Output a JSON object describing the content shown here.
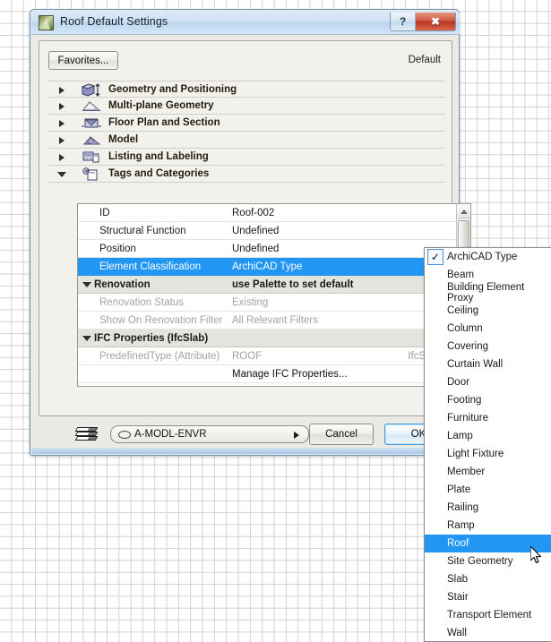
{
  "window": {
    "title": "Roof Default Settings",
    "app_icon": "archicad-roof-icon",
    "help_button": "?",
    "close_button": "✖"
  },
  "toolbar": {
    "favorites_label": "Favorites...",
    "default_label": "Default"
  },
  "tree": {
    "items": [
      {
        "label": "Geometry and Positioning",
        "expanded": false,
        "icon": "geometry-icon"
      },
      {
        "label": "Multi-plane Geometry",
        "expanded": false,
        "icon": "multiplane-icon"
      },
      {
        "label": "Floor Plan and Section",
        "expanded": false,
        "icon": "floorplan-icon"
      },
      {
        "label": "Model",
        "expanded": false,
        "icon": "model-icon"
      },
      {
        "label": "Listing and Labeling",
        "expanded": false,
        "icon": "listing-icon"
      },
      {
        "label": "Tags and Categories",
        "expanded": true,
        "icon": "tags-icon"
      }
    ]
  },
  "grid": {
    "rows": [
      {
        "key": "ID",
        "value": "Roof-002",
        "type": "normal"
      },
      {
        "key": "Structural Function",
        "value": "Undefined",
        "type": "normal"
      },
      {
        "key": "Position",
        "value": "Undefined",
        "type": "normal"
      },
      {
        "key": "Element Classification",
        "value": "ArchiCAD Type",
        "type": "selected"
      },
      {
        "key": "Renovation",
        "value": "use Palette to set default",
        "type": "section"
      },
      {
        "key": "Renovation Status",
        "value": "Existing",
        "type": "dim",
        "extra_icon": "renovation-status-icon"
      },
      {
        "key": "Show On Renovation Filter",
        "value": "All Relevant Filters",
        "type": "dim"
      },
      {
        "key": "IFC Properties (IfcSlab)",
        "value": "",
        "type": "section"
      },
      {
        "key": "PredefinedType (Attribute)",
        "value": "ROOF",
        "type": "dim",
        "extra": "IfcSlab..."
      },
      {
        "key": "",
        "value": "Manage IFC Properties...",
        "type": "manage"
      }
    ]
  },
  "footer": {
    "layers_icon": "layers-icon",
    "layer_value": "A-MODL-ENVR",
    "cancel_label": "Cancel",
    "ok_label": "OK"
  },
  "menu": {
    "items": [
      {
        "label": "ArchiCAD Type",
        "state": "checked"
      },
      {
        "label": "Beam",
        "state": "normal"
      },
      {
        "label": "Building Element Proxy",
        "state": "normal"
      },
      {
        "label": "Ceiling",
        "state": "normal"
      },
      {
        "label": "Column",
        "state": "normal"
      },
      {
        "label": "Covering",
        "state": "normal"
      },
      {
        "label": "Curtain Wall",
        "state": "normal"
      },
      {
        "label": "Door",
        "state": "normal"
      },
      {
        "label": "Footing",
        "state": "normal"
      },
      {
        "label": "Furniture",
        "state": "normal"
      },
      {
        "label": "Lamp",
        "state": "normal"
      },
      {
        "label": "Light Fixture",
        "state": "normal"
      },
      {
        "label": "Member",
        "state": "normal"
      },
      {
        "label": "Plate",
        "state": "normal"
      },
      {
        "label": "Railing",
        "state": "normal"
      },
      {
        "label": "Ramp",
        "state": "normal"
      },
      {
        "label": "Roof",
        "state": "highlighted"
      },
      {
        "label": "Site Geometry",
        "state": "normal"
      },
      {
        "label": "Slab",
        "state": "normal"
      },
      {
        "label": "Stair",
        "state": "normal"
      },
      {
        "label": "Transport Element",
        "state": "normal"
      },
      {
        "label": "Wall",
        "state": "normal"
      }
    ],
    "check_glyph": "✓"
  },
  "colors": {
    "selection_blue": "#2196f3",
    "title_blue": "#cfe2f4",
    "close_red": "#b83621"
  }
}
